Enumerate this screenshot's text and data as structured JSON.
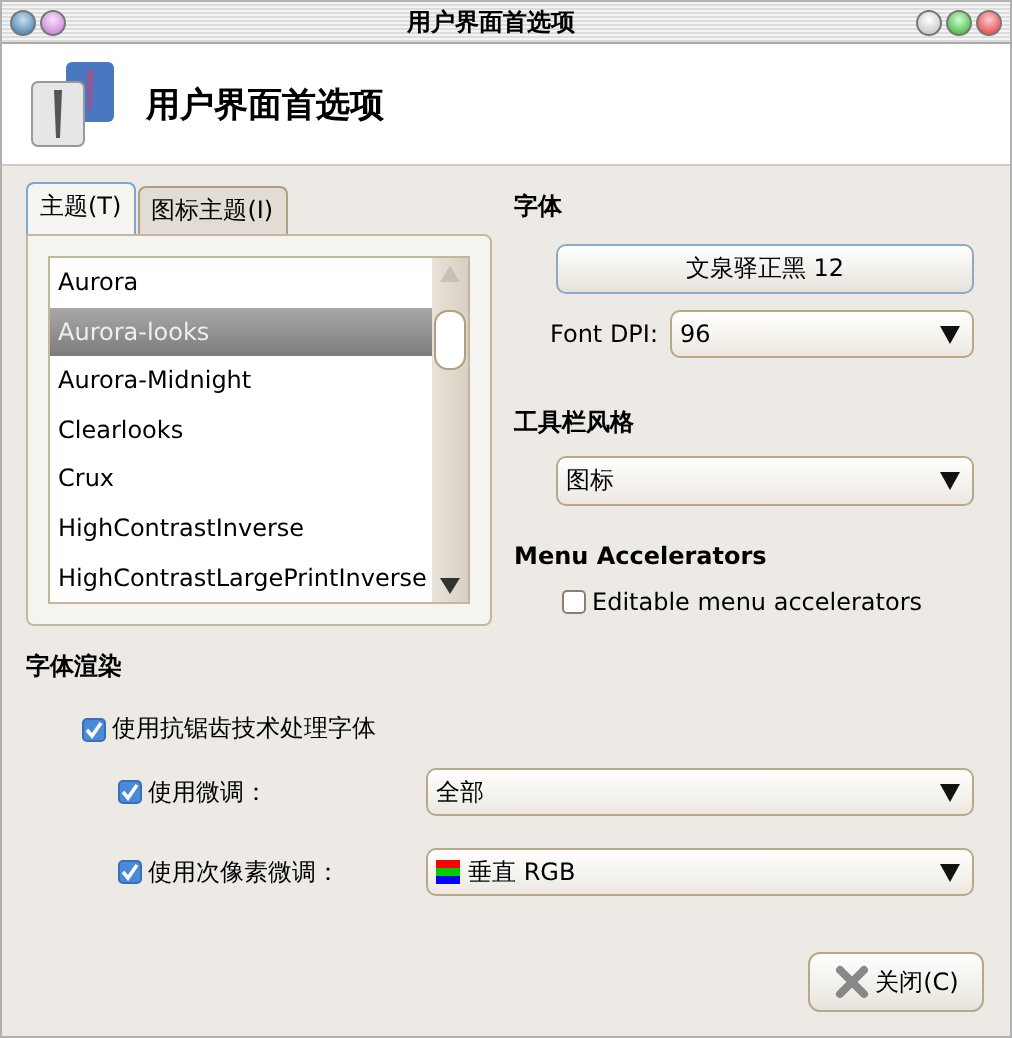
{
  "window": {
    "title": "用户界面首选项"
  },
  "header": {
    "title": "用户界面首选项"
  },
  "tabs": [
    {
      "label": "主题(T)",
      "selected": true
    },
    {
      "label": "图标主题(I)",
      "selected": false
    }
  ],
  "theme_list": [
    {
      "label": "Aurora",
      "selected": false
    },
    {
      "label": "Aurora-looks",
      "selected": true
    },
    {
      "label": "Aurora-Midnight",
      "selected": false
    },
    {
      "label": "Clearlooks",
      "selected": false
    },
    {
      "label": "Crux",
      "selected": false
    },
    {
      "label": "HighContrastInverse",
      "selected": false
    },
    {
      "label": "HighContrastLargePrintInverse",
      "selected": false
    }
  ],
  "font": {
    "heading": "字体",
    "button": "文泉驿正黑 12",
    "dpi_label": "Font DPI:",
    "dpi_value": "96"
  },
  "toolbar_style": {
    "heading": "工具栏风格",
    "value": "图标"
  },
  "menu_accelerators": {
    "heading": "Menu Accelerators",
    "label": "Editable menu accelerators",
    "checked": false
  },
  "font_rendering": {
    "heading": "字体渲染",
    "antialias": {
      "label": "使用抗锯齿技术处理字体",
      "checked": true
    },
    "options": [
      {
        "kind": "plain",
        "label": "使用微调：",
        "checked": true,
        "value": "全部"
      },
      {
        "kind": "subpixel",
        "label": "使用次像素微调：",
        "checked": true,
        "value": "垂直 RGB"
      }
    ]
  },
  "buttons": [
    {
      "label": "关闭(C)"
    }
  ]
}
